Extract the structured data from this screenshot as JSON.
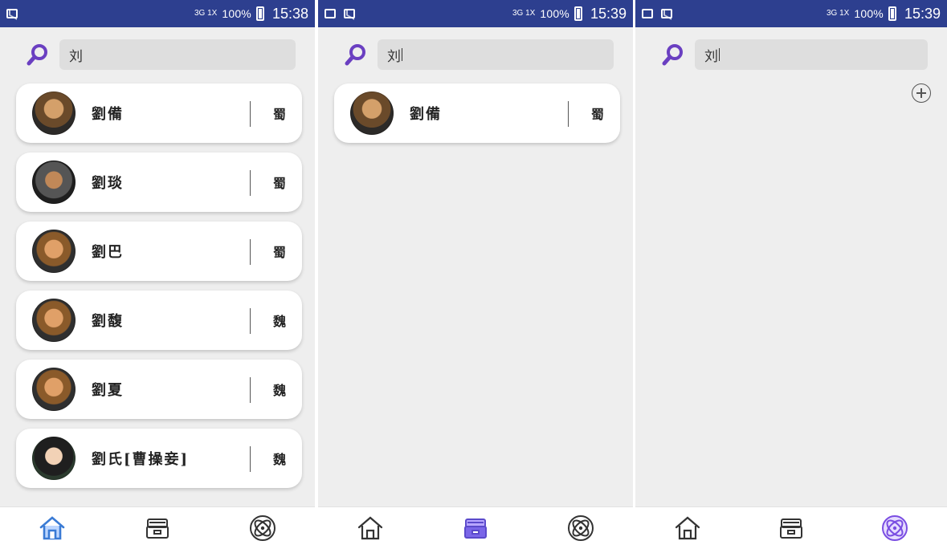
{
  "status": {
    "battery": "100%",
    "times": [
      "15:38",
      "15:39",
      "15:39"
    ],
    "signal_label": "3G 1X"
  },
  "search": {
    "query": "刘"
  },
  "list_screen_1": [
    {
      "name": "劉備",
      "kingdom": "蜀"
    },
    {
      "name": "劉琰",
      "kingdom": "蜀"
    },
    {
      "name": "劉巴",
      "kingdom": "蜀"
    },
    {
      "name": "劉馥",
      "kingdom": "魏"
    },
    {
      "name": "劉夏",
      "kingdom": "魏"
    },
    {
      "name": "劉氏[曹操妾]",
      "kingdom": "魏"
    }
  ],
  "list_screen_2": [
    {
      "name": "劉備",
      "kingdom": "蜀"
    }
  ],
  "nav": {
    "items": [
      "home-icon",
      "inbox-icon",
      "atom-icon"
    ],
    "active_color": "#6a5acd",
    "inactive_color": "#333333"
  },
  "colors": {
    "status_bar": "#2d3f8f",
    "search_icon": "#6a3fc1"
  }
}
